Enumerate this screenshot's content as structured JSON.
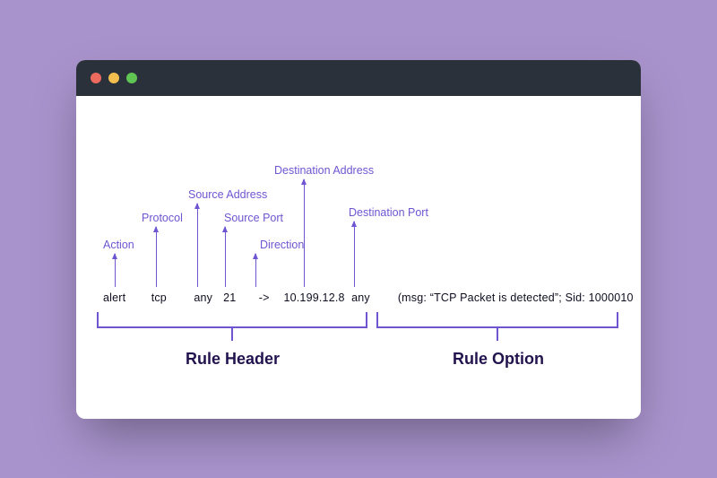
{
  "tokens": {
    "action": "alert",
    "protocol": "tcp",
    "src_addr": "any",
    "src_port": "21",
    "direction": "->",
    "dst_addr": "10.199.12.8",
    "dst_port": "any",
    "options": "(msg: “TCP Packet is detected”; Sid: 1000010"
  },
  "labels": {
    "action": "Action",
    "protocol": "Protocol",
    "src_addr": "Source Address",
    "src_port": "Source Port",
    "direction": "Direction",
    "dst_addr": "Destination Address",
    "dst_port": "Destination Port"
  },
  "sections": {
    "header": "Rule Header",
    "option": "Rule Option"
  }
}
